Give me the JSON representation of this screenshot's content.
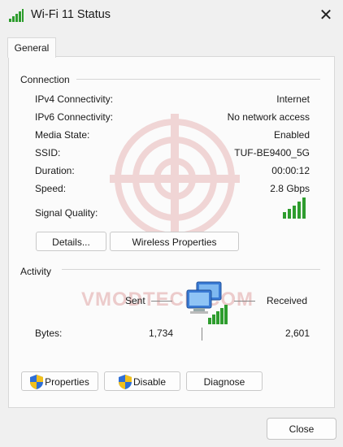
{
  "window": {
    "title": "Wi-Fi 11 Status",
    "close_glyph": "✕"
  },
  "tabs": [
    {
      "label": "General"
    }
  ],
  "connection": {
    "group_label": "Connection",
    "rows": [
      {
        "label": "IPv4 Connectivity:",
        "value": "Internet"
      },
      {
        "label": "IPv6 Connectivity:",
        "value": "No network access"
      },
      {
        "label": "Media State:",
        "value": "Enabled"
      },
      {
        "label": "SSID:",
        "value": "TUF-BE9400_5G"
      },
      {
        "label": "Duration:",
        "value": "00:00:12"
      },
      {
        "label": "Speed:",
        "value": "2.8 Gbps"
      }
    ],
    "signal_label": "Signal Quality:",
    "signal_bars_filled": 5,
    "signal_bars_total": 5,
    "details_button": "Details...",
    "wireless_properties_button": "Wireless Properties"
  },
  "activity": {
    "group_label": "Activity",
    "sent_label": "Sent",
    "received_label": "Received",
    "bytes_label": "Bytes:",
    "bytes_sent": "1,734",
    "bytes_received": "2,601",
    "properties_button": "Properties",
    "disable_button": "Disable",
    "diagnose_button": "Diagnose"
  },
  "footer": {
    "close_button": "Close"
  },
  "watermark": {
    "text": "VMODTECH.COM"
  },
  "colors": {
    "signal_green": "#2e9d2e",
    "shield_blue": "#2f6fd6",
    "shield_yellow": "#f2c01b"
  },
  "icons": [
    "wifi-signal-icon",
    "shield-icon",
    "network-computers-icon",
    "close-icon"
  ]
}
